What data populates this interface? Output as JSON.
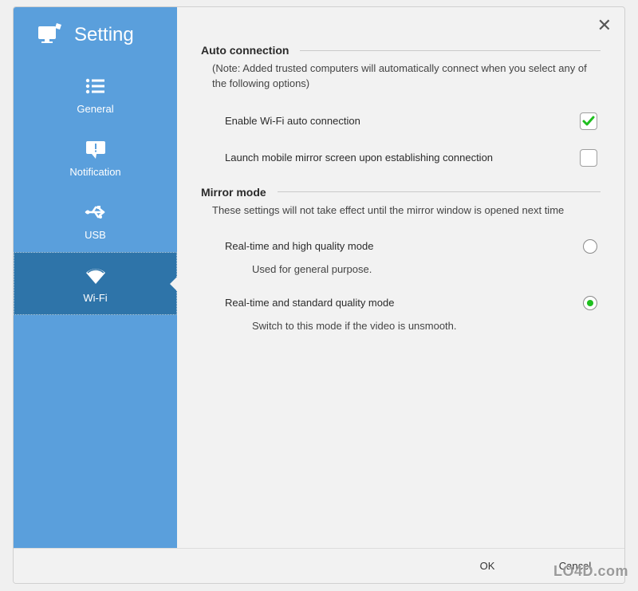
{
  "header": {
    "title": "Setting"
  },
  "sidebar": {
    "items": [
      {
        "label": "General",
        "icon": "list-icon"
      },
      {
        "label": "Notification",
        "icon": "notification-icon"
      },
      {
        "label": "USB",
        "icon": "usb-icon"
      },
      {
        "label": "Wi-Fi",
        "icon": "wifi-icon"
      }
    ],
    "active_index": 3
  },
  "main": {
    "sections": [
      {
        "title": "Auto connection",
        "note": "(Note: Added trusted computers will automatically connect when you select any of the following options)",
        "options": [
          {
            "label": "Enable Wi-Fi auto connection",
            "type": "checkbox",
            "checked": true
          },
          {
            "label": "Launch mobile mirror screen upon establishing connection",
            "type": "checkbox",
            "checked": false
          }
        ]
      },
      {
        "title": "Mirror mode",
        "note": "These settings will not take effect until the mirror window is opened next time",
        "options": [
          {
            "label": "Real-time and high quality mode",
            "sublabel": "Used for general purpose.",
            "type": "radio",
            "selected": false
          },
          {
            "label": "Real-time and standard quality mode",
            "sublabel": "Switch to this mode if the video is unsmooth.",
            "type": "radio",
            "selected": true
          }
        ]
      }
    ]
  },
  "footer": {
    "ok": "OK",
    "cancel": "Cancel"
  },
  "watermark": "LO4D.com",
  "colors": {
    "sidebar": "#5a9fdc",
    "sidebar_active": "#2e74a9",
    "check_green": "#1fbf1f"
  }
}
